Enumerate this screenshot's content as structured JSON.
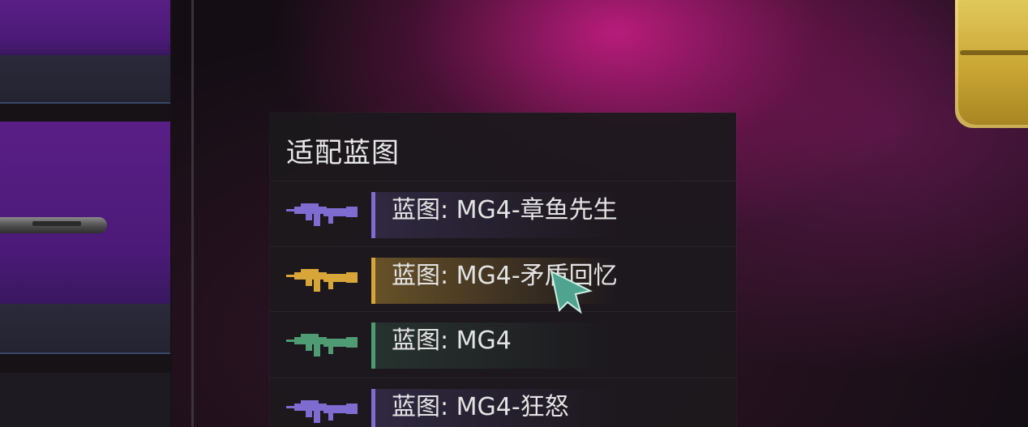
{
  "panel": {
    "title": "适配蓝图",
    "items": [
      {
        "label": "蓝图: MG4-章鱼先生",
        "color": "#7e6cd0",
        "icon": "gun-icon",
        "selected": false
      },
      {
        "label": "蓝图: MG4-矛盾回忆",
        "color": "#d8a638",
        "icon": "gun-icon",
        "selected": true
      },
      {
        "label": "蓝图: MG4",
        "color": "#4f9b74",
        "icon": "gun-icon",
        "selected": false
      },
      {
        "label": "蓝图: MG4-狂怒",
        "color": "#7e6cd0",
        "icon": "gun-icon",
        "selected": false
      }
    ]
  },
  "cursor": {
    "icon": "pointer-cursor-icon",
    "color": "#4fa48f"
  }
}
